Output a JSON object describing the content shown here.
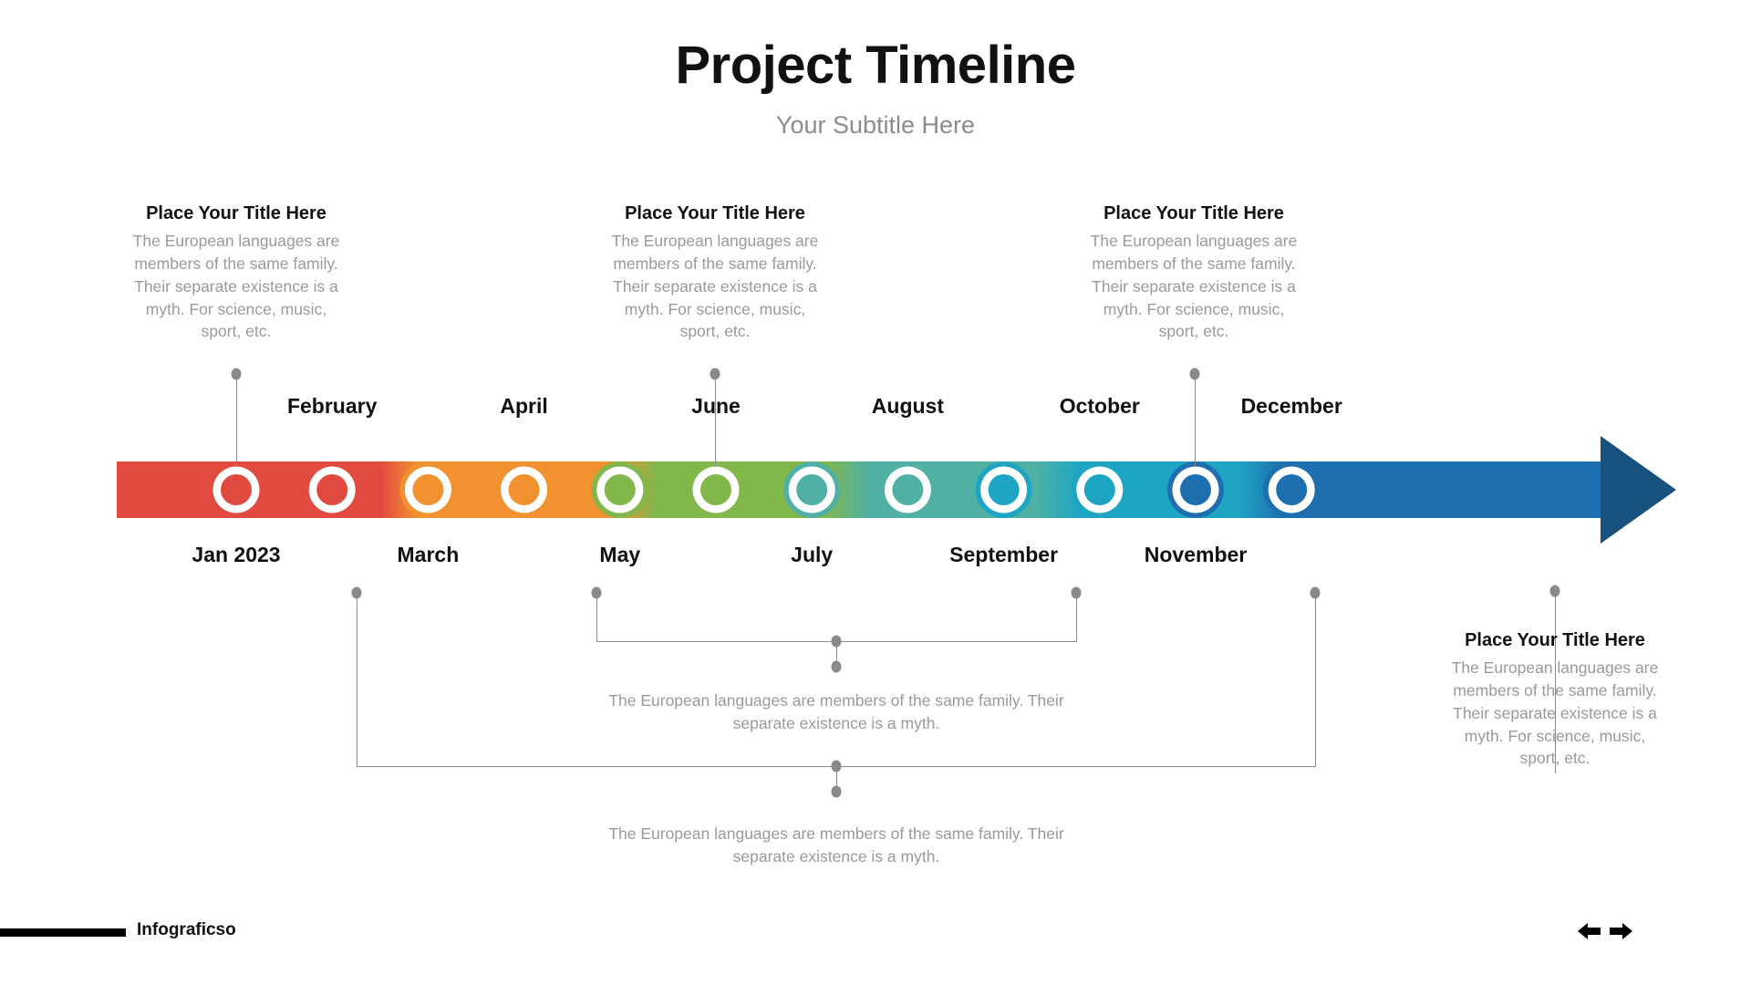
{
  "header": {
    "title": "Project Timeline",
    "subtitle": "Your Subtitle Here"
  },
  "callouts": {
    "top": [
      {
        "title": "Place Your Title Here",
        "body": "The European languages are members of the same family. Their separate existence is a myth. For science, music, sport, etc."
      },
      {
        "title": "Place Your Title Here",
        "body": "The European languages are members of the same family. Their separate existence is a myth. For science, music, sport, etc."
      },
      {
        "title": "Place Your Title Here",
        "body": "The European languages are members of the same family. Their separate existence is a myth. For science, music, sport, etc."
      }
    ],
    "right": {
      "title": "Place Your Title Here",
      "body": "The European languages are members of the same family. Their separate existence is a myth. For science, music, sport, etc."
    },
    "bottom": [
      {
        "body": "The European languages are members of the same family. Their separate existence is a myth."
      },
      {
        "body": "The European languages are members of the same family. Their separate existence is a myth."
      }
    ]
  },
  "chart_data": {
    "type": "table",
    "title": "Project Timeline",
    "milestones": [
      {
        "label": "Jan 2023",
        "position": "below",
        "color": "#e04a3f"
      },
      {
        "label": "February",
        "position": "above",
        "color": "#e04a3f"
      },
      {
        "label": "March",
        "position": "below",
        "color": "#f2912f"
      },
      {
        "label": "April",
        "position": "above",
        "color": "#f2912f"
      },
      {
        "label": "May",
        "position": "below",
        "color": "#82b74b"
      },
      {
        "label": "June",
        "position": "above",
        "color": "#82b74b"
      },
      {
        "label": "July",
        "position": "below",
        "color": "#50b0a4"
      },
      {
        "label": "August",
        "position": "above",
        "color": "#50b0a4"
      },
      {
        "label": "September",
        "position": "below",
        "color": "#1fa5c4"
      },
      {
        "label": "October",
        "position": "above",
        "color": "#1fa5c4"
      },
      {
        "label": "November",
        "position": "below",
        "color": "#1d6fb0"
      },
      {
        "label": "December",
        "position": "above",
        "color": "#1d6fb0"
      }
    ]
  },
  "palette": {
    "red": "#e04a3f",
    "orange": "#f2912f",
    "green": "#82b74b",
    "teal": "#50b0a4",
    "cyan": "#1fa5c4",
    "blue": "#1d6fb0",
    "arrowhead": "#17517e",
    "connector": "#8a8a8a",
    "body_text": "#9a9a9a",
    "heading_text": "#111111",
    "subtitle_text": "#8c8c8c"
  },
  "footer": {
    "brand": "Infograficso",
    "prev_icon": "arrow-left-icon",
    "next_icon": "arrow-right-icon"
  }
}
